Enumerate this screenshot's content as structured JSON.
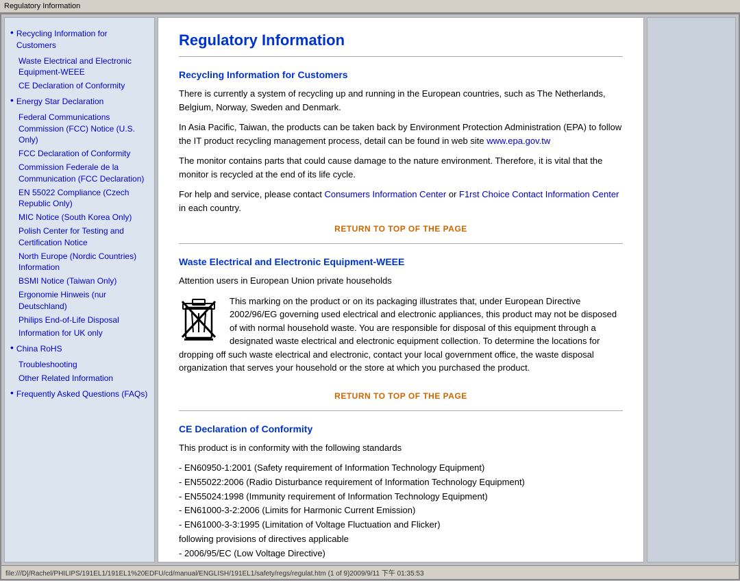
{
  "titlebar": {
    "text": "Regulatory Information"
  },
  "sidebar": {
    "items": [
      {
        "label": "Recycling Information for Customers",
        "bullet": true,
        "sub": false
      },
      {
        "label": "Waste Electrical and Electronic Equipment-WEEE",
        "bullet": false,
        "sub": true
      },
      {
        "label": "CE Declaration of Conformity",
        "bullet": false,
        "sub": true
      },
      {
        "label": "Energy Star Declaration",
        "bullet": true,
        "sub": false
      },
      {
        "label": "Federal Communications Commission (FCC) Notice (U.S. Only)",
        "bullet": false,
        "sub": true
      },
      {
        "label": "FCC Declaration of Conformity",
        "bullet": false,
        "sub": true
      },
      {
        "label": "Commission Federale de la Communication (FCC Declaration)",
        "bullet": false,
        "sub": true
      },
      {
        "label": "EN 55022 Compliance (Czech Republic Only)",
        "bullet": false,
        "sub": true
      },
      {
        "label": "MIC Notice (South Korea Only)",
        "bullet": false,
        "sub": true
      },
      {
        "label": "Polish Center for Testing and Certification Notice",
        "bullet": false,
        "sub": true
      },
      {
        "label": "North Europe (Nordic Countries) Information",
        "bullet": false,
        "sub": true
      },
      {
        "label": "BSMI Notice (Taiwan Only)",
        "bullet": false,
        "sub": true
      },
      {
        "label": "Ergonomie Hinweis (nur Deutschland)",
        "bullet": false,
        "sub": true
      },
      {
        "label": "Philips End-of-Life Disposal",
        "bullet": false,
        "sub": true
      },
      {
        "label": "Information for UK only",
        "bullet": false,
        "sub": true
      },
      {
        "label": "China RoHS",
        "bullet": true,
        "sub": false
      },
      {
        "label": "Troubleshooting",
        "bullet": false,
        "sub": true
      },
      {
        "label": "Other Related Information",
        "bullet": false,
        "sub": true
      },
      {
        "label": "Frequently Asked Questions (FAQs)",
        "bullet": true,
        "sub": false
      }
    ]
  },
  "main": {
    "page_title": "Regulatory Information",
    "sections": [
      {
        "id": "recycling",
        "title": "Recycling Information for Customers",
        "paragraphs": [
          "There is currently a system of recycling up and running in the European countries, such as The Netherlands, Belgium, Norway, Sweden and Denmark.",
          "In Asia Pacific, Taiwan, the products can be taken back by Environment Protection Administration (EPA) to follow the IT product recycling management process, detail can be found in web site www.epa.gov.tw",
          "The monitor contains parts that could cause damage to the nature environment. Therefore, it is vital that the monitor is recycled at the end of its life cycle.",
          "For help and service, please contact Consumers Information Center or F1rst Choice Contact Information Center in each country."
        ],
        "links": [
          {
            "text": "www.epa.gov.tw",
            "href": "#"
          },
          {
            "text": "Consumers Information Center",
            "href": "#"
          },
          {
            "text": "F1rst Choice Contact Information Center",
            "href": "#"
          }
        ]
      },
      {
        "id": "weee",
        "title": "Waste Electrical and Electronic Equipment-WEEE",
        "paragraphs": [
          "Attention users in European Union private households",
          "This marking on the product or on its packaging illustrates that, under European Directive 2002/96/EG governing used electrical and electronic appliances, this product may not be disposed of with normal household waste. You are responsible for disposal of this equipment through a designated waste electrical and electronic equipment collection. To determine the locations for dropping off such waste electrical and electronic, contact your local government office, the waste disposal organization that serves your household or the store at which you purchased the product."
        ]
      },
      {
        "id": "ce",
        "title": "CE Declaration of Conformity",
        "paragraphs": [
          "This product is in conformity with the following standards",
          "- EN60950-1:2001 (Safety requirement of Information Technology Equipment)\n- EN55022:2006 (Radio Disturbance requirement of Information Technology Equipment)\n- EN55024:1998 (Immunity requirement of Information Technology Equipment)\n- EN61000-3-2:2006 (Limits for Harmonic Current Emission)\n- EN61000-3-3:1995 (Limitation of Voltage Fluctuation and Flicker)\nfollowing provisions of directives applicable\n- 2006/95/EC (Low Voltage Directive)"
        ]
      }
    ],
    "return_label": "RETURN TO TOP OF THE PAGE"
  },
  "bottom_bar": {
    "text": "file:///D|/Rachel/PHILIPS/191EL1/191EL1%20EDFU/cd/manual/ENGLISH/191EL1/safety/regs/regulat.htm (1 of 9)2009/9/11 下午 01:35:53"
  }
}
